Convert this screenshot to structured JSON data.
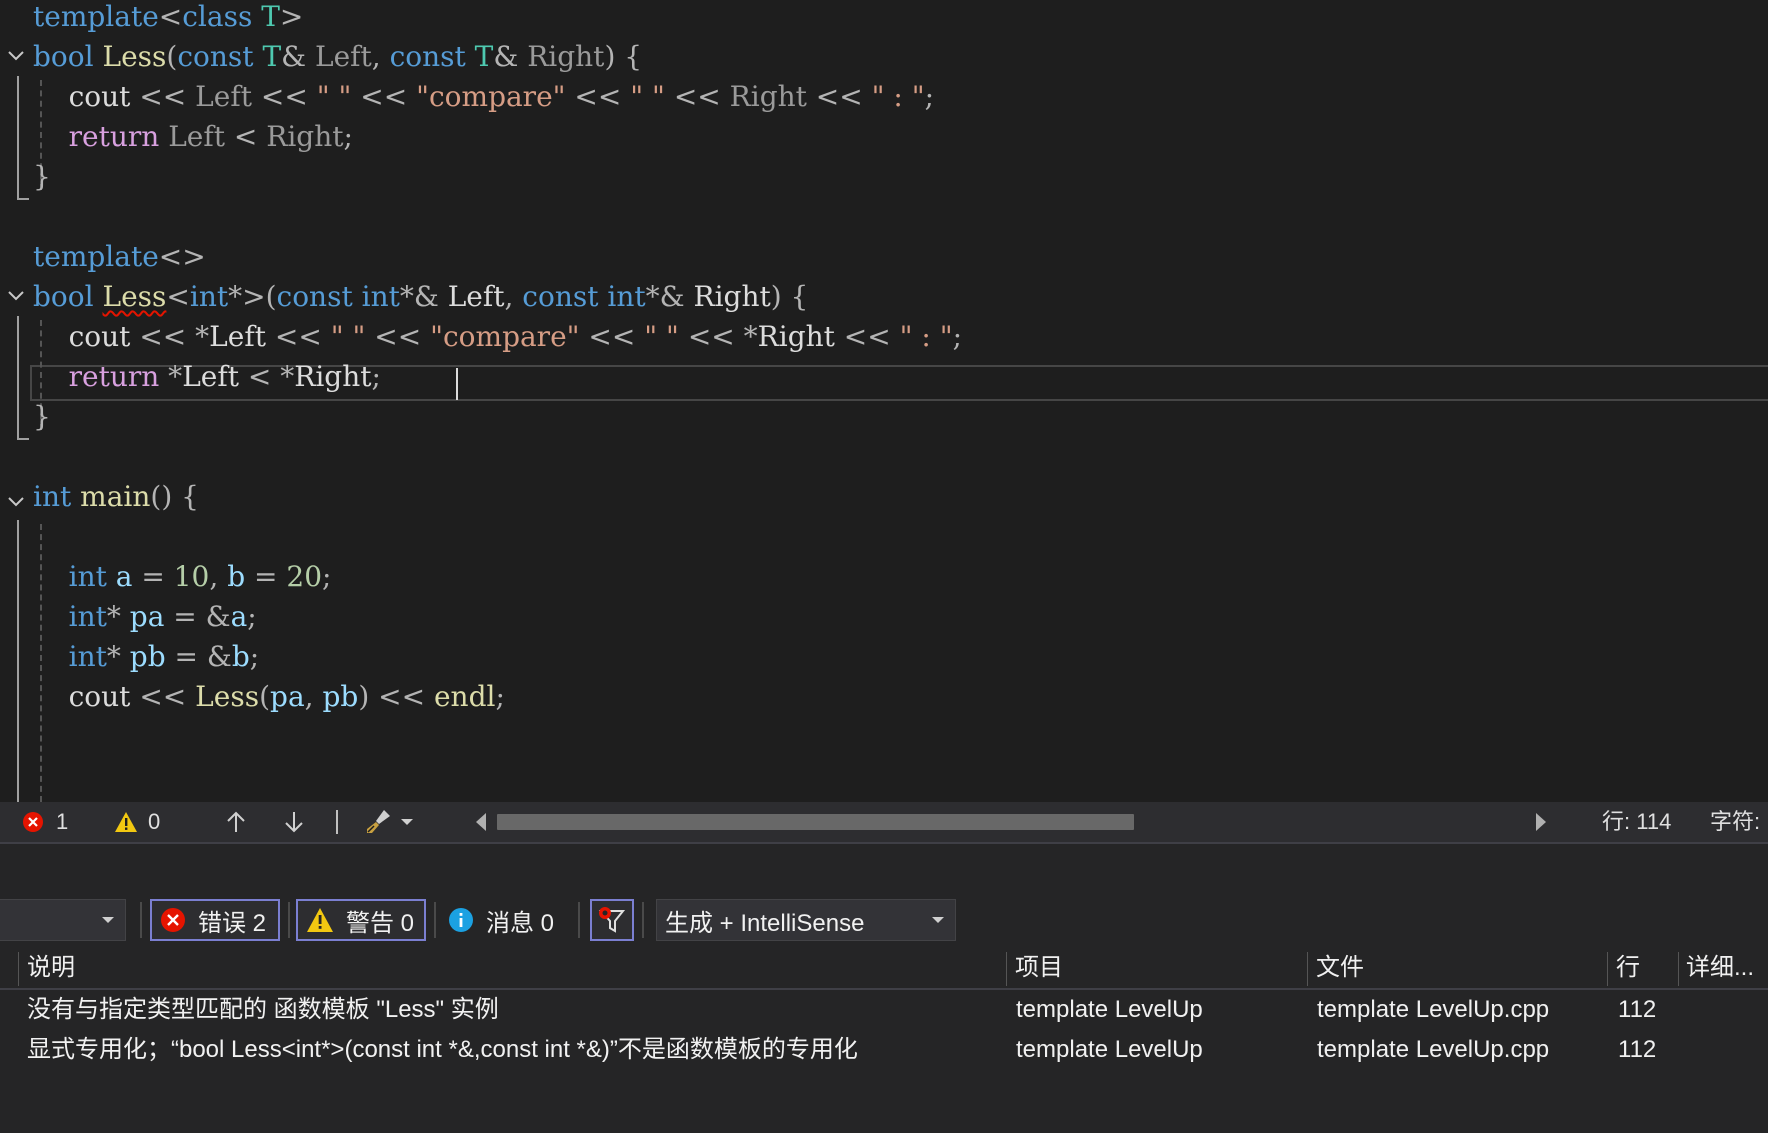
{
  "editor": {
    "lines": [
      [
        [
          "template",
          "kw"
        ],
        [
          "<",
          "op"
        ],
        [
          "class",
          "kw"
        ],
        [
          " ",
          "id"
        ],
        [
          "T",
          "type"
        ],
        [
          ">",
          "op"
        ]
      ],
      [
        [
          "bool",
          "kw"
        ],
        [
          " ",
          "id"
        ],
        [
          "Less",
          "fn"
        ],
        [
          "(",
          "op"
        ],
        [
          "const",
          "kw"
        ],
        [
          " ",
          "id"
        ],
        [
          "T",
          "type"
        ],
        [
          "& ",
          "op"
        ],
        [
          "Left",
          "pid"
        ],
        [
          ", ",
          "op"
        ],
        [
          "const",
          "kw"
        ],
        [
          " ",
          "id"
        ],
        [
          "T",
          "type"
        ],
        [
          "& ",
          "op"
        ],
        [
          "Right",
          "pid"
        ],
        [
          ") {",
          "op"
        ]
      ],
      [
        [
          "    cout",
          "id"
        ],
        [
          " << ",
          "op"
        ],
        [
          "Left",
          "pid"
        ],
        [
          " << ",
          "op"
        ],
        [
          "\" \"",
          "str"
        ],
        [
          " << ",
          "op"
        ],
        [
          "\"compare\"",
          "str"
        ],
        [
          " << ",
          "op"
        ],
        [
          "\" \"",
          "str"
        ],
        [
          " << ",
          "op"
        ],
        [
          "Right",
          "pid"
        ],
        [
          " << ",
          "op"
        ],
        [
          "\" : \"",
          "str"
        ],
        [
          ";",
          "op"
        ]
      ],
      [
        [
          "    ",
          "id"
        ],
        [
          "return",
          "ctl"
        ],
        [
          " ",
          "id"
        ],
        [
          "Left",
          "pid"
        ],
        [
          " < ",
          "op"
        ],
        [
          "Right",
          "pid"
        ],
        [
          ";",
          "op"
        ]
      ],
      [
        [
          "}",
          "op"
        ]
      ],
      [],
      [
        [
          "template",
          "kw"
        ],
        [
          "<>",
          "op"
        ]
      ],
      [
        [
          "bool",
          "kw"
        ],
        [
          " ",
          "id"
        ],
        [
          "Less",
          "fn",
          "squiggle"
        ],
        [
          "<",
          "op"
        ],
        [
          "int",
          "kw"
        ],
        [
          "*>(",
          "op"
        ],
        [
          "const",
          "kw"
        ],
        [
          " ",
          "id"
        ],
        [
          "int",
          "kw"
        ],
        [
          "*& ",
          "op"
        ],
        [
          "Left",
          "id"
        ],
        [
          ", ",
          "op"
        ],
        [
          "const",
          "kw"
        ],
        [
          " ",
          "id"
        ],
        [
          "int",
          "kw"
        ],
        [
          "*& ",
          "op"
        ],
        [
          "Right",
          "id"
        ],
        [
          ") {",
          "op"
        ]
      ],
      [
        [
          "    cout",
          "id"
        ],
        [
          " << *",
          "op"
        ],
        [
          "Left",
          "id"
        ],
        [
          " << ",
          "op"
        ],
        [
          "\" \"",
          "str"
        ],
        [
          " << ",
          "op"
        ],
        [
          "\"compare\"",
          "str"
        ],
        [
          " << ",
          "op"
        ],
        [
          "\" \"",
          "str"
        ],
        [
          " << *",
          "op"
        ],
        [
          "Right",
          "id"
        ],
        [
          " << ",
          "op"
        ],
        [
          "\" : \"",
          "str"
        ],
        [
          ";",
          "op"
        ]
      ],
      [
        [
          "    ",
          "id"
        ],
        [
          "return",
          "ctl"
        ],
        [
          " *",
          "op"
        ],
        [
          "Left",
          "id"
        ],
        [
          " < *",
          "op"
        ],
        [
          "Right",
          "id"
        ],
        [
          ";",
          "op"
        ]
      ],
      [
        [
          "}",
          "op"
        ]
      ],
      [],
      [
        [
          "int",
          "kw"
        ],
        [
          " ",
          "id"
        ],
        [
          "main",
          "fn"
        ],
        [
          "() {",
          "op"
        ]
      ],
      [],
      [
        [
          "    ",
          "id"
        ],
        [
          "int",
          "kw"
        ],
        [
          " ",
          "id"
        ],
        [
          "a",
          "var"
        ],
        [
          " = ",
          "op"
        ],
        [
          "10",
          "num"
        ],
        [
          ", ",
          "op"
        ],
        [
          "b",
          "var"
        ],
        [
          " = ",
          "op"
        ],
        [
          "20",
          "num"
        ],
        [
          ";",
          "op"
        ]
      ],
      [
        [
          "    ",
          "id"
        ],
        [
          "int",
          "kw"
        ],
        [
          "* ",
          "op"
        ],
        [
          "pa",
          "var"
        ],
        [
          " = &",
          "op"
        ],
        [
          "a",
          "var"
        ],
        [
          ";",
          "op"
        ]
      ],
      [
        [
          "    ",
          "id"
        ],
        [
          "int",
          "kw"
        ],
        [
          "* ",
          "op"
        ],
        [
          "pb",
          "var"
        ],
        [
          " = &",
          "op"
        ],
        [
          "b",
          "var"
        ],
        [
          ";",
          "op"
        ]
      ],
      [
        [
          "    cout",
          "id"
        ],
        [
          " << ",
          "op"
        ],
        [
          "Less",
          "fn"
        ],
        [
          "(",
          "op"
        ],
        [
          "pa",
          "var"
        ],
        [
          ", ",
          "op"
        ],
        [
          "pb",
          "var"
        ],
        [
          ") << ",
          "op"
        ],
        [
          "endl",
          "fn"
        ],
        [
          ";",
          "op"
        ]
      ]
    ]
  },
  "status": {
    "error_count": "1",
    "warning_count": "0",
    "line_label": "行: 114",
    "char_label": "字符:"
  },
  "error_list": {
    "toolbar": {
      "errors_label": "错误 2",
      "warnings_label": "警告 0",
      "messages_label": "消息 0",
      "build_filter": "生成 + IntelliSense"
    },
    "columns": {
      "description": "说明",
      "project": "项目",
      "file": "文件",
      "line": "行",
      "details": "详细..."
    },
    "rows": [
      {
        "description": "没有与指定类型匹配的 函数模板 \"Less\" 实例",
        "project": "template LevelUp",
        "file": "template LevelUp.cpp",
        "line": "112"
      },
      {
        "description": "显式专用化；“bool Less<int*>(const int *&,const int *&)”不是函数模板的专用化",
        "project": "template LevelUp",
        "file": "template LevelUp.cpp",
        "line": "112"
      }
    ]
  },
  "colors": {
    "keyword": "#569cd6",
    "control": "#d8a0df",
    "function": "#dcdcaa",
    "string": "#d69d85",
    "number": "#b5cea8",
    "type": "#4ec9b0",
    "variable": "#9cdcfe",
    "error": "#e51400",
    "warning": "#f2c811",
    "info": "#1ba1e2",
    "filter_border": "#7b7fd1"
  }
}
